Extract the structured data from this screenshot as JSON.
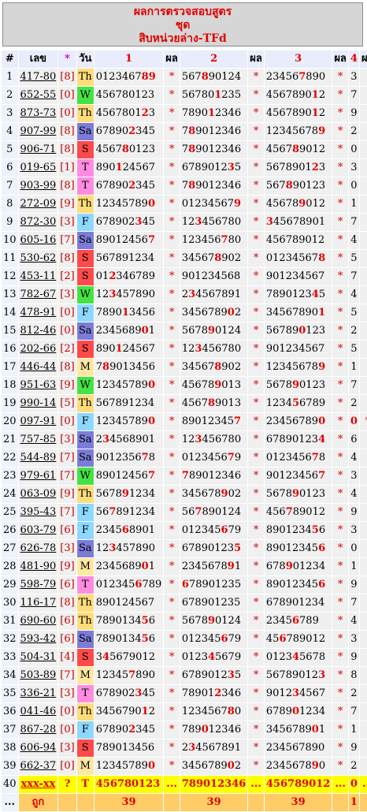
{
  "header": {
    "title": "ผลการตรวจสอบสูตร",
    "set_label": "ชุด",
    "formula_name": "สิบหน่วยล่าง-TFd"
  },
  "columns": {
    "no": "#",
    "lek": "เลข",
    "star": "*",
    "day": "วัน",
    "set1": "1",
    "res1": "ผล",
    "set2": "2",
    "res2": "ผล",
    "set3": "3",
    "res3": "ผล",
    "set4": "4",
    "res4": "ผล"
  },
  "rows": [
    {
      "no": "1",
      "lek": "417-80",
      "br": "[8]",
      "day": "Th",
      "n1": "0123467",
      "h1": "89",
      "r1": "*",
      "n2": "567",
      "h2": "8",
      "t2": "90124",
      "r2": "*",
      "n3": "23456",
      "h3": "7",
      "t3": "890",
      "r3": "*",
      "r4": "3"
    },
    {
      "no": "2",
      "lek": "652-55",
      "br": "[0]",
      "day": "W",
      "n1": "456780123",
      "r1": "*",
      "n2": "56780",
      "h2": "1",
      "t2": "235",
      "r2": "*",
      "n3": "4567890",
      "h3": "1",
      "t3": "2",
      "r3": "*",
      "r4": "7"
    },
    {
      "no": "3",
      "lek": "873-73",
      "br": "[0]",
      "day": "Th",
      "n1": "4567801",
      "h1": "2",
      "t1": "3",
      "r1": "*",
      "n2": "7890",
      "h2": "1",
      "t2": "2346",
      "r2": "*",
      "n3": "4567890",
      "h3": "1",
      "t3": "2",
      "r3": "*",
      "r4": "9"
    },
    {
      "no": "4",
      "lek": "907-99",
      "br": "[8]",
      "day": "Sa",
      "n1": "67890",
      "h1": "2",
      "t1": "345",
      "r1": "*",
      "n2": "7",
      "h2": "8",
      "t2": "9012346",
      "r2": "*",
      "n3": "12345678",
      "h3": "9",
      "r3": "*",
      "r4": "2"
    },
    {
      "no": "5",
      "lek": "906-71",
      "br": "[8]",
      "day": "S",
      "n1": "4567",
      "h1": "8",
      "t1": "0123",
      "r1": "*",
      "n2": "7",
      "h2": "8",
      "t2": "9012346",
      "r2": "*",
      "n3": "4567",
      "h3": "8",
      "t3": "9012",
      "r3": "*",
      "r4": "0"
    },
    {
      "no": "6",
      "lek": "019-65",
      "br": "[1]",
      "day": "T",
      "n1": "890",
      "h1": "1",
      "t1": "24567",
      "r1": "*",
      "n2": "6789012",
      "h2": "3",
      "t2": "5",
      "r2": "*",
      "n3": "5678901",
      "h3": "2",
      "t3": "3",
      "r3": "*",
      "r4": "3"
    },
    {
      "no": "7",
      "lek": "903-99",
      "br": "[8]",
      "day": "T",
      "n1": "67890",
      "h1": "2",
      "t1": "345",
      "r1": "*",
      "n2": "7",
      "h2": "8",
      "t2": "9012346",
      "r2": "*",
      "n3": "567",
      "h3": "8",
      "t3": "90123",
      "r3": "*",
      "r4": "0"
    },
    {
      "no": "8",
      "lek": "272-09",
      "br": "[9]",
      "day": "Th",
      "n1": "12345789",
      "h1": "0",
      "r1": "*",
      "n2": "01234567",
      "h2": "9",
      "r2": "*",
      "n3": "45678",
      "h3": "9",
      "t3": "012",
      "r3": "*",
      "r4": "1"
    },
    {
      "no": "9",
      "lek": "872-30",
      "br": "[3]",
      "day": "F",
      "n1": "678902",
      "h1": "3",
      "t1": "45",
      "r1": "*",
      "n2": "12",
      "h2": "3",
      "t2": "456780",
      "r2": "*",
      "n3": "",
      "h3": "3",
      "t3": "45678901",
      "r3": "*",
      "r4": "7"
    },
    {
      "no": "10",
      "lek": "605-16",
      "br": "[7]",
      "day": "Sa",
      "n1": "89012456",
      "h1": "7",
      "r1": "*",
      "n2": "123456",
      "h2": "7",
      "t2": "80",
      "r2": "*",
      "n3": "456789012",
      "r3": "*",
      "r4": "4"
    },
    {
      "no": "11",
      "lek": "530-62",
      "br": "[8]",
      "day": "S",
      "n1": "567891234",
      "r1": "*",
      "n2": "34567",
      "h2": "8",
      "t2": "902",
      "r2": "*",
      "n3": "01234567",
      "h3": "8",
      "r3": "*",
      "r4": "5"
    },
    {
      "no": "12",
      "lek": "453-11",
      "br": "[2]",
      "day": "S",
      "n1": "01",
      "h1": "2",
      "t1": "346789",
      "r1": "*",
      "n2": "901234568",
      "r2": "*",
      "n3": "901234567",
      "r3": "*",
      "r4": "7"
    },
    {
      "no": "13",
      "lek": "782-67",
      "br": "[3]",
      "day": "W",
      "n1": "12",
      "h1": "3",
      "t1": "457890",
      "r1": "*",
      "n2": "2",
      "h2": "3",
      "t2": "4567891",
      "r2": "*",
      "n3": "7890123",
      "h3": "4",
      "t3": "5",
      "r3": "*",
      "r4": "4"
    },
    {
      "no": "14",
      "lek": "478-91",
      "br": "[0]",
      "day": "F",
      "n1": "7890",
      "h1": "1",
      "t1": "3456",
      "r1": "*",
      "n2": "3456789",
      "h2": "0",
      "t2": "2",
      "r2": "*",
      "n3": "34567890",
      "h3": "1",
      "r3": "*",
      "r4": "5"
    },
    {
      "no": "15",
      "lek": "812-46",
      "br": "[0]",
      "day": "Sa",
      "n1": "2345689",
      "h1": "0",
      "t1": "1",
      "r1": "*",
      "n2": "5678",
      "h2": "9",
      "t2": "0124",
      "r2": "*",
      "n3": "56789",
      "h3": "0",
      "t3": "123",
      "r3": "*",
      "r4": "2"
    },
    {
      "no": "16",
      "lek": "202-66",
      "br": "[2]",
      "day": "S",
      "n1": "890",
      "h1": "1",
      "t1": "24567",
      "r1": "*",
      "n2": "12",
      "h2": "3",
      "t2": "456780",
      "r2": "*",
      "n3": "901234567",
      "r3": "*",
      "r4": "5"
    },
    {
      "no": "17",
      "lek": "446-44",
      "br": "[8]",
      "day": "M",
      "n1": "7",
      "h1": "8",
      "t1": "9013456",
      "r1": "*",
      "n2": "34567",
      "h2": "8",
      "t2": "902",
      "r2": "*",
      "n3": "12345678",
      "h3": "9",
      "r3": "*",
      "r4": "1"
    },
    {
      "no": "18",
      "lek": "951-63",
      "br": "[9]",
      "day": "W",
      "n1": "12345789",
      "h1": "0",
      "r1": "*",
      "n2": "45678",
      "h2": "9",
      "t2": "013",
      "r2": "*",
      "n3": "5678",
      "h3": "9",
      "t3": "0123",
      "r3": "*",
      "r4": "7"
    },
    {
      "no": "19",
      "lek": "990-14",
      "br": "[5]",
      "day": "Th",
      "n1": "567891234",
      "r1": "*",
      "n2": "4567",
      "h2": "8",
      "t2": "9013",
      "r2": "*",
      "n3": "1234",
      "h3": "5",
      "t3": "6789",
      "r3": "*",
      "r4": "2"
    },
    {
      "no": "20",
      "lek": "097-91",
      "br": "[0]",
      "day": "F",
      "n1": "12345789",
      "h1": "0",
      "r1": "*",
      "n2": "89012345",
      "h2": "7",
      "r2": "*",
      "n3": "23456789",
      "h3": "0",
      "r3": "*",
      "r4": "0",
      "r4hit": true,
      "last": "*"
    },
    {
      "no": "21",
      "lek": "757-85",
      "br": "[3]",
      "day": "Sa",
      "n1": "2",
      "h1": "3",
      "t1": "4568901",
      "r1": "*",
      "n2": "12",
      "h2": "3",
      "t2": "456780",
      "r2": "*",
      "n3": "67890123",
      "h3": "4",
      "r3": "*",
      "r4": "6"
    },
    {
      "no": "22",
      "lek": "544-89",
      "br": "[7]",
      "day": "Sa",
      "n1": "9012356",
      "h1": "7",
      "t1": "8",
      "r1": "*",
      "n2": "0123456",
      "h2": "7",
      "t2": "9",
      "r2": "*",
      "n3": "0123456",
      "h3": "7",
      "t3": "8",
      "r3": "*",
      "r4": "4"
    },
    {
      "no": "23",
      "lek": "979-61",
      "br": "[7]",
      "day": "W",
      "n1": "89012456",
      "h1": "7",
      "r1": "*",
      "n2": "",
      "h2": "7",
      "t2": "89012346",
      "r2": "*",
      "n3": "90123456",
      "h3": "7",
      "r3": "*",
      "r4": "3"
    },
    {
      "no": "24",
      "lek": "063-09",
      "br": "[9]",
      "day": "Th",
      "n1": "5678",
      "h1": "9",
      "t1": "1234",
      "r1": "*",
      "n2": "345678",
      "h2": "9",
      "t2": "02",
      "r2": "*",
      "n3": "5678",
      "h3": "9",
      "t3": "0123",
      "r3": "*",
      "r4": "4"
    },
    {
      "no": "25",
      "lek": "395-43",
      "br": "[7]",
      "day": "F",
      "n1": "56",
      "h1": "7",
      "t1": "891234",
      "r1": "*",
      "n2": "56",
      "h2": "7",
      "t2": "890124",
      "r2": "*",
      "n3": "456",
      "h3": "7",
      "t3": "89012",
      "r3": "*",
      "r4": "9"
    },
    {
      "no": "26",
      "lek": "603-79",
      "br": "[6]",
      "day": "F",
      "n1": "2345",
      "h1": "6",
      "t1": "8901",
      "r1": "*",
      "n2": "012345",
      "h2": "6",
      "t2": "79",
      "r2": "*",
      "n3": "8901234",
      "h3": "5",
      "t3": "6",
      "r3": "*",
      "r4": "3"
    },
    {
      "no": "27",
      "lek": "626-78",
      "br": "[3]",
      "day": "Sa",
      "n1": "12",
      "h1": "3",
      "t1": "457890",
      "r1": "*",
      "n2": "67890123",
      "h2": "5",
      "r2": "*",
      "n3": "89012345",
      "h3": "6",
      "r3": "*",
      "r4": "0"
    },
    {
      "no": "28",
      "lek": "481-90",
      "br": "[9]",
      "day": "M",
      "n1": "2345689",
      "h1": "0",
      "t1": "1",
      "r1": "*",
      "n2": "2345678",
      "h2": "9",
      "t2": "1",
      "r2": "*",
      "n3": "678",
      "h3": "9",
      "t3": "01234",
      "r3": "*",
      "r4": "1"
    },
    {
      "no": "29",
      "lek": "598-79",
      "br": "[6]",
      "day": "T",
      "n1": "012345",
      "h1": "6",
      "t1": "789",
      "r1": "*",
      "n2": "",
      "h2": "6",
      "t2": "78901235",
      "r2": "*",
      "n3": "89012345",
      "h3": "6",
      "r3": "*",
      "r4": "9"
    },
    {
      "no": "30",
      "lek": "116-17",
      "br": "[8]",
      "day": "Th",
      "n1": "890124567",
      "r1": "*",
      "n2": "678901235",
      "r2": "*",
      "n3": "678901234",
      "r3": "*",
      "r4": "7"
    },
    {
      "no": "31",
      "lek": "690-60",
      "br": "[6]",
      "day": "Th",
      "n1": "7890134",
      "h1": "5",
      "t1": "6",
      "r1": "*",
      "n2": "5678",
      "h2": "9",
      "t2": "0124",
      "r2": "*",
      "n3": "2345",
      "h3": "6",
      "t3": "789",
      "r3": "*",
      "r4": "4"
    },
    {
      "no": "32",
      "lek": "593-42",
      "br": "[6]",
      "day": "Sa",
      "n1": "7890134",
      "h1": "5",
      "t1": "6",
      "r1": "*",
      "n2": "012345",
      "h2": "6",
      "t2": "79",
      "r2": "*",
      "n3": "45",
      "h3": "6",
      "t3": "789012",
      "r3": "*",
      "r4": "3"
    },
    {
      "no": "33",
      "lek": "504-31",
      "br": "[4]",
      "day": "S",
      "n1": "3",
      "h1": "4",
      "t1": "5679012",
      "r1": "*",
      "n2": "0123",
      "h2": "4",
      "t2": "5679",
      "r2": "*",
      "n3": "0123",
      "h3": "4",
      "t3": "5678",
      "r3": "*",
      "r4": "9"
    },
    {
      "no": "34",
      "lek": "503-89",
      "br": "[7]",
      "day": "M",
      "n1": "12345",
      "h1": "7",
      "t1": "890",
      "r1": "*",
      "n2": "6789012",
      "h2": "3",
      "t2": "5",
      "r2": "*",
      "n3": "56789012",
      "h3": "3",
      "r3": "*",
      "r4": "8"
    },
    {
      "no": "35",
      "lek": "336-21",
      "br": "[3]",
      "day": "T",
      "n1": "678902",
      "h1": "3",
      "t1": "45",
      "r1": "*",
      "n2": "78901",
      "h2": "2",
      "t2": "346",
      "r2": "*",
      "n3": "9012",
      "h3": "3",
      "t3": "4567",
      "r3": "*",
      "r4": "2"
    },
    {
      "no": "36",
      "lek": "041-46",
      "br": "[0]",
      "day": "Th",
      "n1": "3456790",
      "h1": "1",
      "t1": "2",
      "r1": "*",
      "n2": "1234567",
      "h2": "8",
      "t2": "0",
      "r2": "*",
      "n3": "6789",
      "h3": "0",
      "t3": "1234",
      "r3": "*",
      "r4": "7"
    },
    {
      "no": "37",
      "lek": "867-28",
      "br": "[0]",
      "day": "F",
      "n1": "67890",
      "h1": "2",
      "t1": "345",
      "r1": "*",
      "n2": "789",
      "h2": "0",
      "t2": "12346",
      "r2": "*",
      "n3": "3456789",
      "h3": "0",
      "t3": "1",
      "r3": "*",
      "r4": "1"
    },
    {
      "no": "38",
      "lek": "606-94",
      "br": "[3]",
      "day": "S",
      "n1": "789013456",
      "r1": "*",
      "n2": "2",
      "h2": "3",
      "t2": "4567891",
      "r2": "*",
      "n3": "234567890",
      "r3": "*",
      "r4": "9"
    },
    {
      "no": "39",
      "lek": "662-37",
      "br": "[0]",
      "day": "M",
      "n1": "12345789",
      "h1": "0",
      "r1": "*",
      "n2": "3456789",
      "h2": "0",
      "t2": "2",
      "r2": "*",
      "n3": "2345678",
      "h3": "9",
      "t3": "0",
      "r3": "*",
      "r4": "2"
    }
  ],
  "pending_row": {
    "no": "40",
    "lek": "xxx-xx",
    "br": "?",
    "day": "T",
    "n1": "456780123",
    "r1": "...",
    "n2": "789012346",
    "r2": "...",
    "n3": "456789012",
    "r3": "...",
    "r4": "0",
    "last": "..."
  },
  "totals": {
    "no": "...",
    "label": "ถูก",
    "s1": "39",
    "s2": "39",
    "s3": "39",
    "s4": "1"
  },
  "colors": {
    "Th": "#ffdc7a",
    "Sa": "#7c7cd8",
    "S": "#ff4a4a",
    "T": "#ff8ce0",
    "W": "#44e344",
    "F": "#8cd8ff",
    "M": "#ffe8a0",
    "hit": "#e00000"
  }
}
